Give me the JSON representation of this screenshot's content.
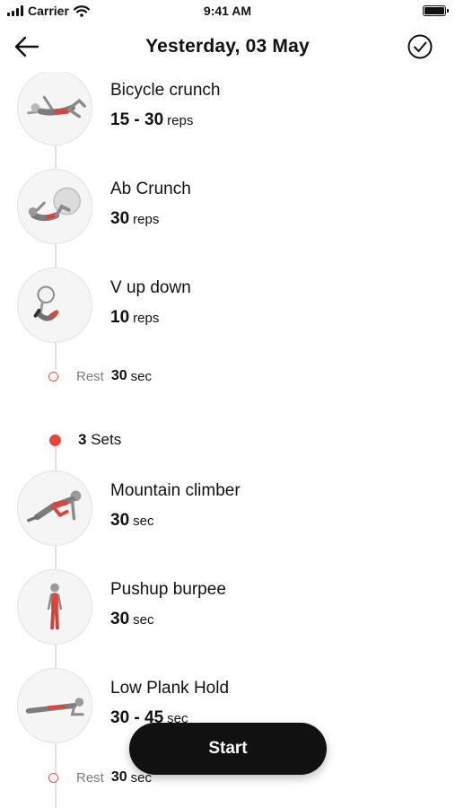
{
  "status_bar": {
    "carrier": "Carrier",
    "time": "9:41 AM",
    "signal_icon": "signal-bars-icon",
    "wifi_icon": "wifi-icon",
    "battery_icon": "battery-icon"
  },
  "header": {
    "title": "Yesterday, 03 May",
    "back_icon": "arrow-left-icon",
    "done_icon": "check-circle-icon"
  },
  "accent_color": "#e8453c",
  "block1": {
    "exercises": [
      {
        "name": "Bicycle crunch",
        "value": "15 - 30",
        "unit": "reps"
      },
      {
        "name": "Ab Crunch",
        "value": "30",
        "unit": "reps"
      },
      {
        "name": "V up down",
        "value": "10",
        "unit": "reps"
      }
    ],
    "rest": {
      "label": "Rest",
      "value": "30",
      "unit": "sec"
    }
  },
  "block2": {
    "sets": {
      "value": "3",
      "label": "Sets"
    },
    "exercises": [
      {
        "name": "Mountain climber",
        "value": "30",
        "unit": "sec"
      },
      {
        "name": "Pushup burpee",
        "value": "30",
        "unit": "sec"
      },
      {
        "name": "Low Plank Hold",
        "value": "30 - 45",
        "unit": "sec"
      }
    ],
    "rest": {
      "label": "Rest",
      "value": "30",
      "unit": "sec"
    }
  },
  "start_button": {
    "label": "Start"
  }
}
